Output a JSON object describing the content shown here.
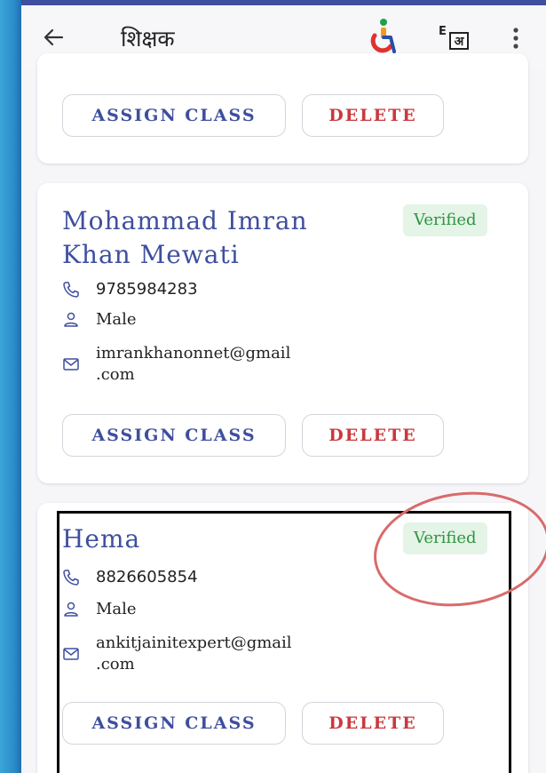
{
  "appbar": {
    "title": "शिक्षक",
    "lang_label_en": "E",
    "lang_label_hi": "अ"
  },
  "cards": [
    {
      "buttons": {
        "assign": "ASSIGN CLASS",
        "delete": "DELETE"
      }
    },
    {
      "name": "Mohammad Imran\nKhan Mewati",
      "badge": "Verified",
      "phone": "9785984283",
      "gender": "Male",
      "email": "imrankhanonnet@gmail\n.com",
      "buttons": {
        "assign": "ASSIGN CLASS",
        "delete": "DELETE"
      }
    },
    {
      "name": "Hema",
      "badge": "Verified",
      "phone": "8826605854",
      "gender": "Male",
      "email": "ankitjainitexpert@gmail\n.com",
      "buttons": {
        "assign": "ASSIGN CLASS",
        "delete": "DELETE"
      }
    }
  ],
  "colors": {
    "primary": "#3f4f9e",
    "danger": "#c9393e",
    "verified_bg": "#e4f4e6",
    "verified_text": "#2f9442",
    "annotation_ellipse": "#d96b6b"
  }
}
